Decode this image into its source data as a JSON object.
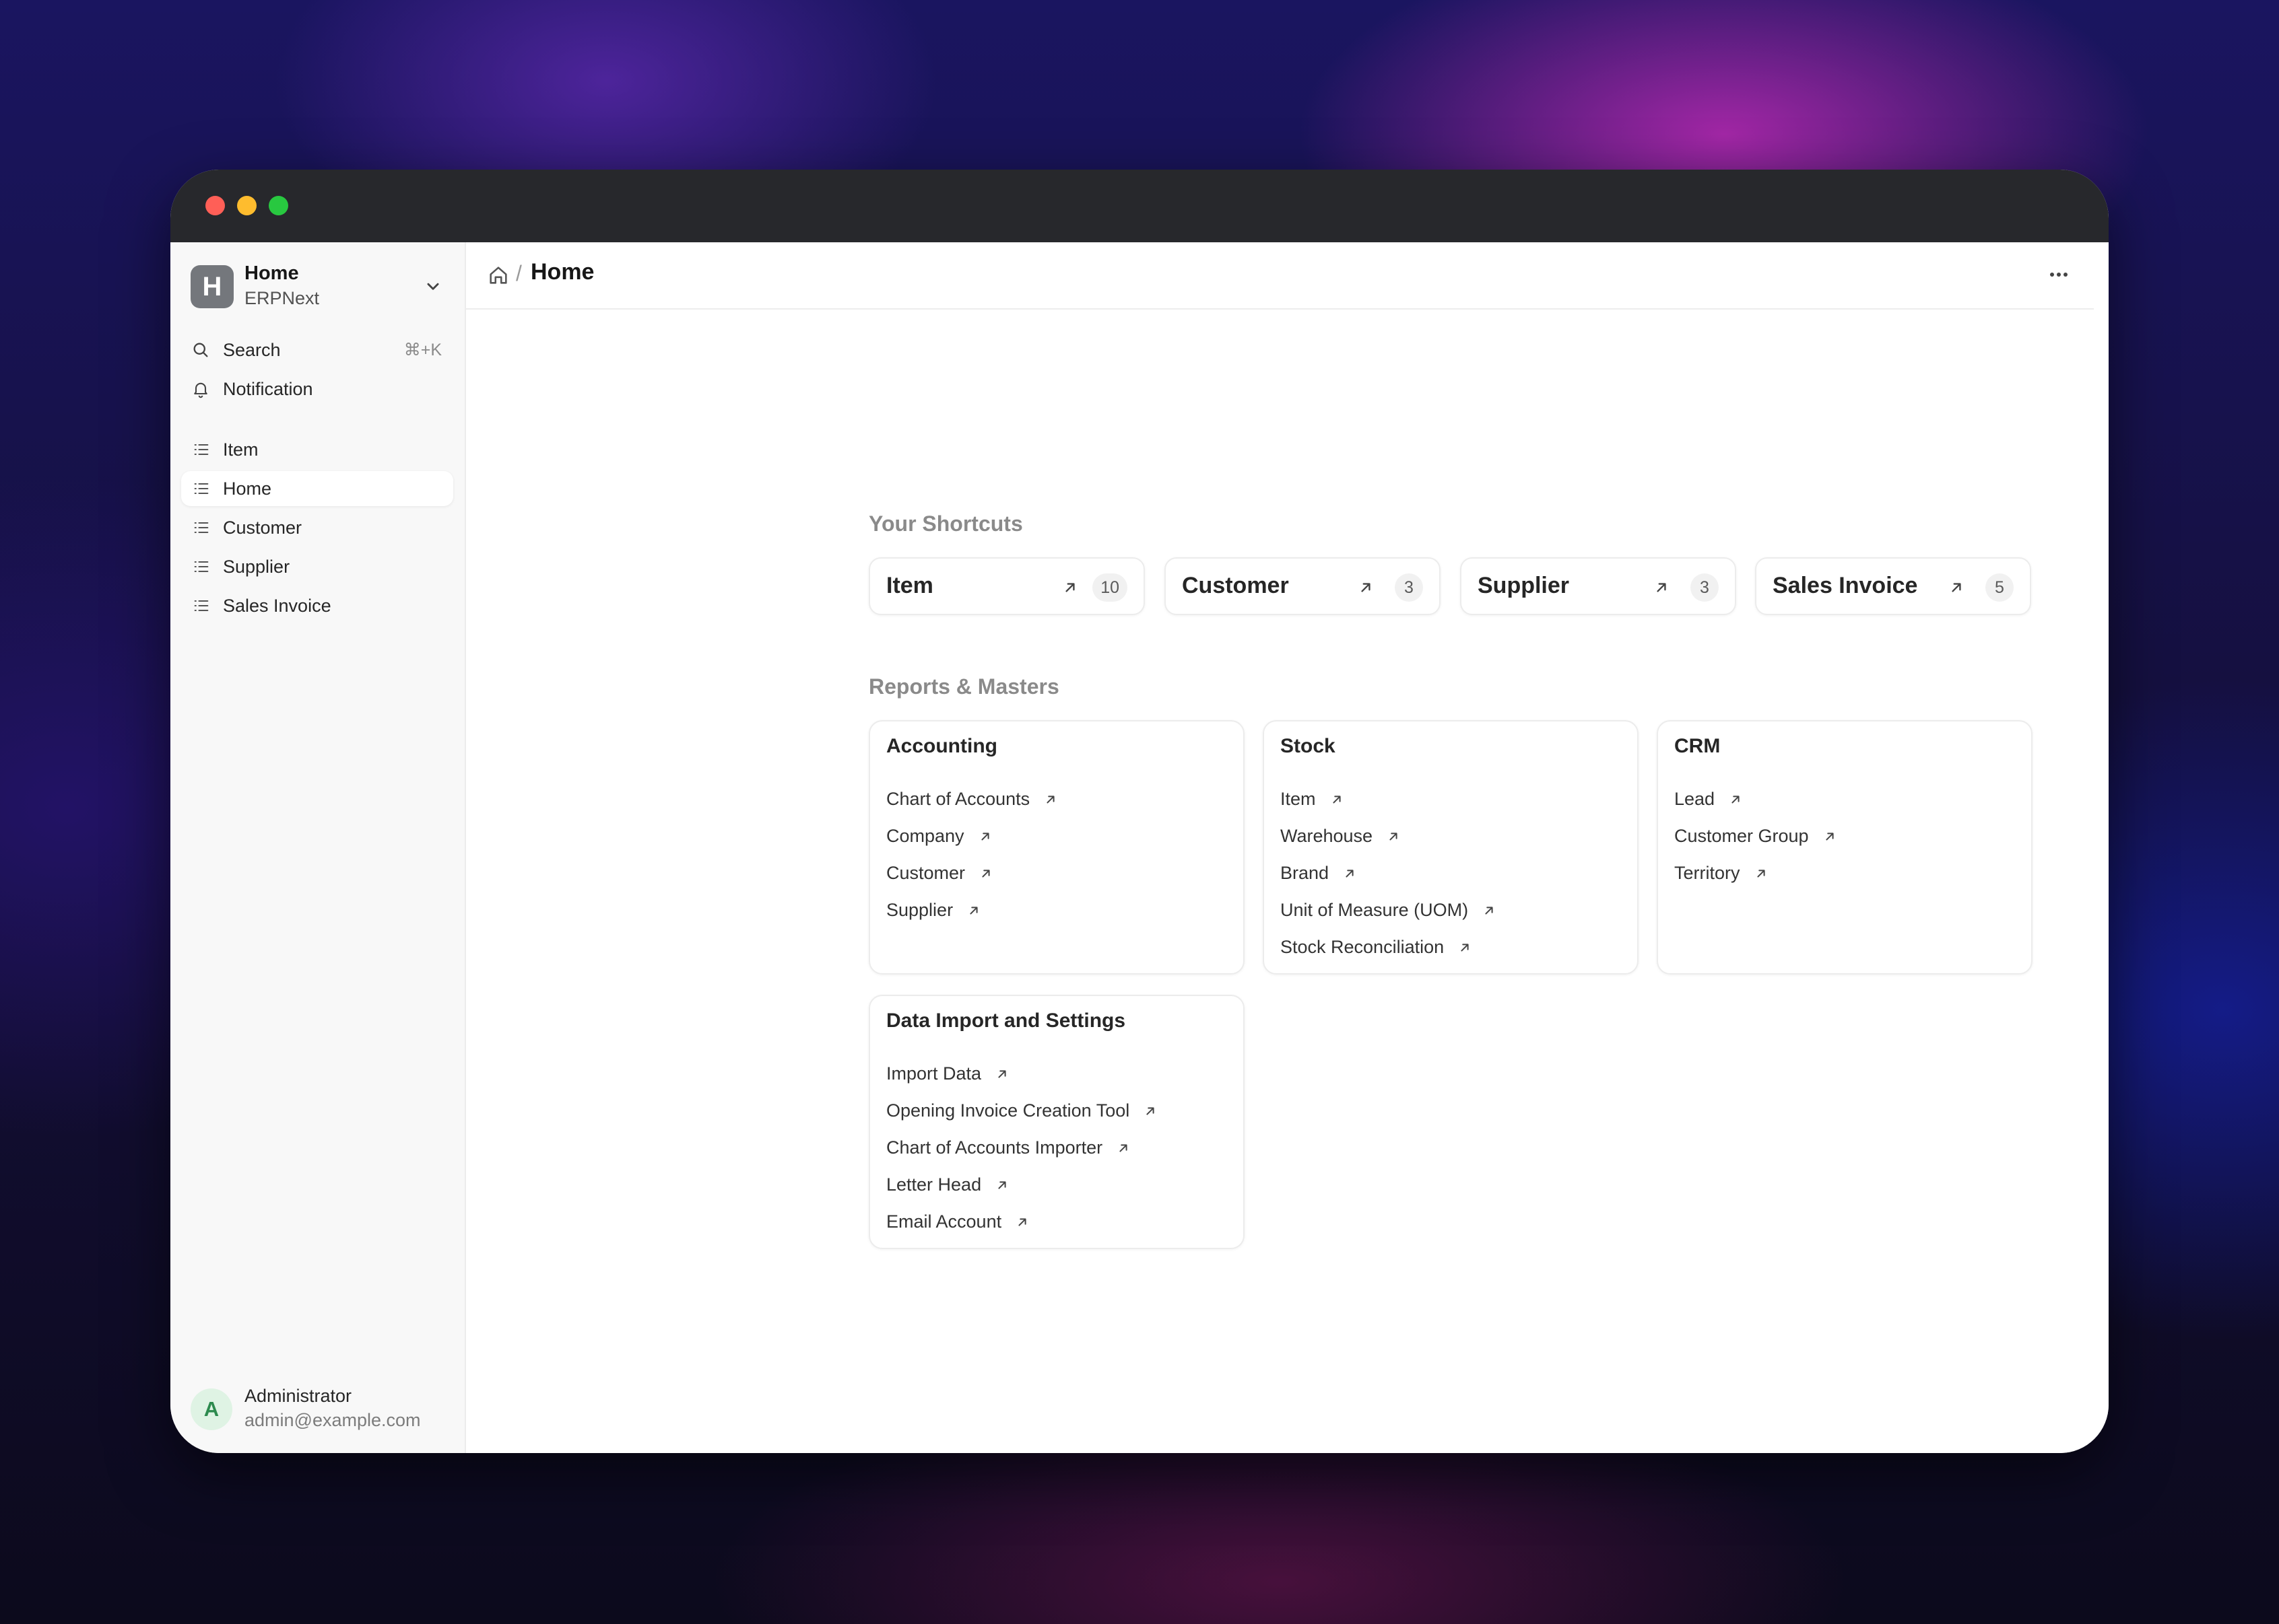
{
  "sidebar": {
    "workspace": {
      "initial": "H",
      "title": "Home",
      "subtitle": "ERPNext"
    },
    "search": {
      "label": "Search",
      "shortcut": "⌘+K"
    },
    "notification": {
      "label": "Notification"
    },
    "items": [
      {
        "label": "Item",
        "active": false
      },
      {
        "label": "Home",
        "active": true
      },
      {
        "label": "Customer",
        "active": false
      },
      {
        "label": "Supplier",
        "active": false
      },
      {
        "label": "Sales Invoice",
        "active": false
      }
    ],
    "user": {
      "initial": "A",
      "name": "Administrator",
      "email": "admin@example.com"
    }
  },
  "header": {
    "breadcrumb_title": "Home",
    "separator": "/"
  },
  "shortcuts": {
    "title": "Your Shortcuts",
    "items": [
      {
        "label": "Item",
        "count": "10"
      },
      {
        "label": "Customer",
        "count": "3"
      },
      {
        "label": "Supplier",
        "count": "3"
      },
      {
        "label": "Sales Invoice",
        "count": "5"
      }
    ]
  },
  "reports": {
    "title": "Reports & Masters",
    "cards": [
      {
        "title": "Accounting",
        "links": [
          "Chart of Accounts",
          "Company",
          "Customer",
          "Supplier"
        ]
      },
      {
        "title": "Stock",
        "links": [
          "Item",
          "Warehouse",
          "Brand",
          "Unit of Measure (UOM)",
          "Stock Reconciliation"
        ]
      },
      {
        "title": "CRM",
        "links": [
          "Lead",
          "Customer Group",
          "Territory"
        ]
      },
      {
        "title": "Data Import and Settings",
        "links": [
          "Import Data",
          "Opening Invoice Creation Tool",
          "Chart of Accounts Importer",
          "Letter Head",
          "Email Account"
        ]
      }
    ]
  },
  "colors": {
    "window_chrome": "#27282c",
    "sidebar_bg": "#f8f8f8",
    "traffic_red": "#ff5f57",
    "traffic_yellow": "#febc2e",
    "traffic_green": "#28c840",
    "avatar_user_bg": "#dff3e4",
    "avatar_user_fg": "#2d8a4e"
  }
}
